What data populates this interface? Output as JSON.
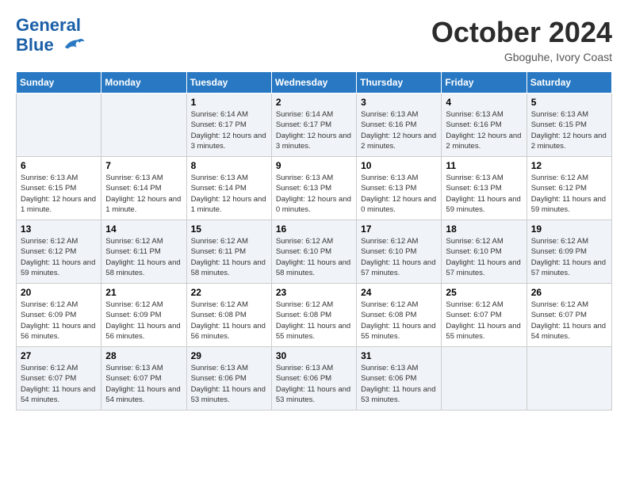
{
  "header": {
    "logo_line1": "General",
    "logo_line2": "Blue",
    "month": "October 2024",
    "location": "Gboguhe, Ivory Coast"
  },
  "weekdays": [
    "Sunday",
    "Monday",
    "Tuesday",
    "Wednesday",
    "Thursday",
    "Friday",
    "Saturday"
  ],
  "weeks": [
    [
      {
        "day": "",
        "info": ""
      },
      {
        "day": "",
        "info": ""
      },
      {
        "day": "1",
        "info": "Sunrise: 6:14 AM\nSunset: 6:17 PM\nDaylight: 12 hours and 3 minutes."
      },
      {
        "day": "2",
        "info": "Sunrise: 6:14 AM\nSunset: 6:17 PM\nDaylight: 12 hours and 3 minutes."
      },
      {
        "day": "3",
        "info": "Sunrise: 6:13 AM\nSunset: 6:16 PM\nDaylight: 12 hours and 2 minutes."
      },
      {
        "day": "4",
        "info": "Sunrise: 6:13 AM\nSunset: 6:16 PM\nDaylight: 12 hours and 2 minutes."
      },
      {
        "day": "5",
        "info": "Sunrise: 6:13 AM\nSunset: 6:15 PM\nDaylight: 12 hours and 2 minutes."
      }
    ],
    [
      {
        "day": "6",
        "info": "Sunrise: 6:13 AM\nSunset: 6:15 PM\nDaylight: 12 hours and 1 minute."
      },
      {
        "day": "7",
        "info": "Sunrise: 6:13 AM\nSunset: 6:14 PM\nDaylight: 12 hours and 1 minute."
      },
      {
        "day": "8",
        "info": "Sunrise: 6:13 AM\nSunset: 6:14 PM\nDaylight: 12 hours and 1 minute."
      },
      {
        "day": "9",
        "info": "Sunrise: 6:13 AM\nSunset: 6:13 PM\nDaylight: 12 hours and 0 minutes."
      },
      {
        "day": "10",
        "info": "Sunrise: 6:13 AM\nSunset: 6:13 PM\nDaylight: 12 hours and 0 minutes."
      },
      {
        "day": "11",
        "info": "Sunrise: 6:13 AM\nSunset: 6:13 PM\nDaylight: 11 hours and 59 minutes."
      },
      {
        "day": "12",
        "info": "Sunrise: 6:12 AM\nSunset: 6:12 PM\nDaylight: 11 hours and 59 minutes."
      }
    ],
    [
      {
        "day": "13",
        "info": "Sunrise: 6:12 AM\nSunset: 6:12 PM\nDaylight: 11 hours and 59 minutes."
      },
      {
        "day": "14",
        "info": "Sunrise: 6:12 AM\nSunset: 6:11 PM\nDaylight: 11 hours and 58 minutes."
      },
      {
        "day": "15",
        "info": "Sunrise: 6:12 AM\nSunset: 6:11 PM\nDaylight: 11 hours and 58 minutes."
      },
      {
        "day": "16",
        "info": "Sunrise: 6:12 AM\nSunset: 6:10 PM\nDaylight: 11 hours and 58 minutes."
      },
      {
        "day": "17",
        "info": "Sunrise: 6:12 AM\nSunset: 6:10 PM\nDaylight: 11 hours and 57 minutes."
      },
      {
        "day": "18",
        "info": "Sunrise: 6:12 AM\nSunset: 6:10 PM\nDaylight: 11 hours and 57 minutes."
      },
      {
        "day": "19",
        "info": "Sunrise: 6:12 AM\nSunset: 6:09 PM\nDaylight: 11 hours and 57 minutes."
      }
    ],
    [
      {
        "day": "20",
        "info": "Sunrise: 6:12 AM\nSunset: 6:09 PM\nDaylight: 11 hours and 56 minutes."
      },
      {
        "day": "21",
        "info": "Sunrise: 6:12 AM\nSunset: 6:09 PM\nDaylight: 11 hours and 56 minutes."
      },
      {
        "day": "22",
        "info": "Sunrise: 6:12 AM\nSunset: 6:08 PM\nDaylight: 11 hours and 56 minutes."
      },
      {
        "day": "23",
        "info": "Sunrise: 6:12 AM\nSunset: 6:08 PM\nDaylight: 11 hours and 55 minutes."
      },
      {
        "day": "24",
        "info": "Sunrise: 6:12 AM\nSunset: 6:08 PM\nDaylight: 11 hours and 55 minutes."
      },
      {
        "day": "25",
        "info": "Sunrise: 6:12 AM\nSunset: 6:07 PM\nDaylight: 11 hours and 55 minutes."
      },
      {
        "day": "26",
        "info": "Sunrise: 6:12 AM\nSunset: 6:07 PM\nDaylight: 11 hours and 54 minutes."
      }
    ],
    [
      {
        "day": "27",
        "info": "Sunrise: 6:12 AM\nSunset: 6:07 PM\nDaylight: 11 hours and 54 minutes."
      },
      {
        "day": "28",
        "info": "Sunrise: 6:13 AM\nSunset: 6:07 PM\nDaylight: 11 hours and 54 minutes."
      },
      {
        "day": "29",
        "info": "Sunrise: 6:13 AM\nSunset: 6:06 PM\nDaylight: 11 hours and 53 minutes."
      },
      {
        "day": "30",
        "info": "Sunrise: 6:13 AM\nSunset: 6:06 PM\nDaylight: 11 hours and 53 minutes."
      },
      {
        "day": "31",
        "info": "Sunrise: 6:13 AM\nSunset: 6:06 PM\nDaylight: 11 hours and 53 minutes."
      },
      {
        "day": "",
        "info": ""
      },
      {
        "day": "",
        "info": ""
      }
    ]
  ]
}
